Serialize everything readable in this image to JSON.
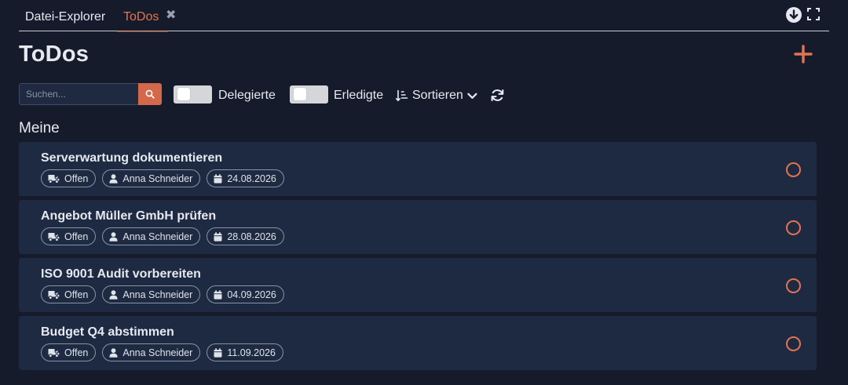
{
  "tabs": [
    {
      "label": "Datei-Explorer",
      "active": false
    },
    {
      "label": "ToDos",
      "active": true,
      "closable": true
    }
  ],
  "tab_close_symbol": "✖",
  "header": {
    "title": "ToDos"
  },
  "toolbar": {
    "search_placeholder": "Suchen...",
    "delegated_label": "Delegierte",
    "delegated_on": false,
    "completed_label": "Erledigte",
    "completed_on": false,
    "sort_label": "Sortieren"
  },
  "section": {
    "title": "Meine"
  },
  "todos": [
    {
      "title": "Serverwartung dokumentieren",
      "status": "Offen",
      "assignee": "Anna Schneider",
      "date": "24.08.2026"
    },
    {
      "title": "Angebot Müller GmbH prüfen",
      "status": "Offen",
      "assignee": "Anna Schneider",
      "date": "28.08.2026"
    },
    {
      "title": "ISO 9001 Audit vorbereiten",
      "status": "Offen",
      "assignee": "Anna Schneider",
      "date": "04.09.2026"
    },
    {
      "title": "Budget Q4 abstimmen",
      "status": "Offen",
      "assignee": "Anna Schneider",
      "date": "11.09.2026"
    }
  ],
  "icons": {
    "download": "download-circle-icon",
    "fullscreen": "fullscreen-icon",
    "add": "plus-icon",
    "search": "search-icon",
    "sort": "sort-icon",
    "refresh": "refresh-icon",
    "status": "truck-icon",
    "assignee": "user-icon",
    "date": "calendar-icon"
  },
  "colors": {
    "accent": "#e3744f",
    "background": "#151b2b",
    "card": "#1e2a42"
  }
}
